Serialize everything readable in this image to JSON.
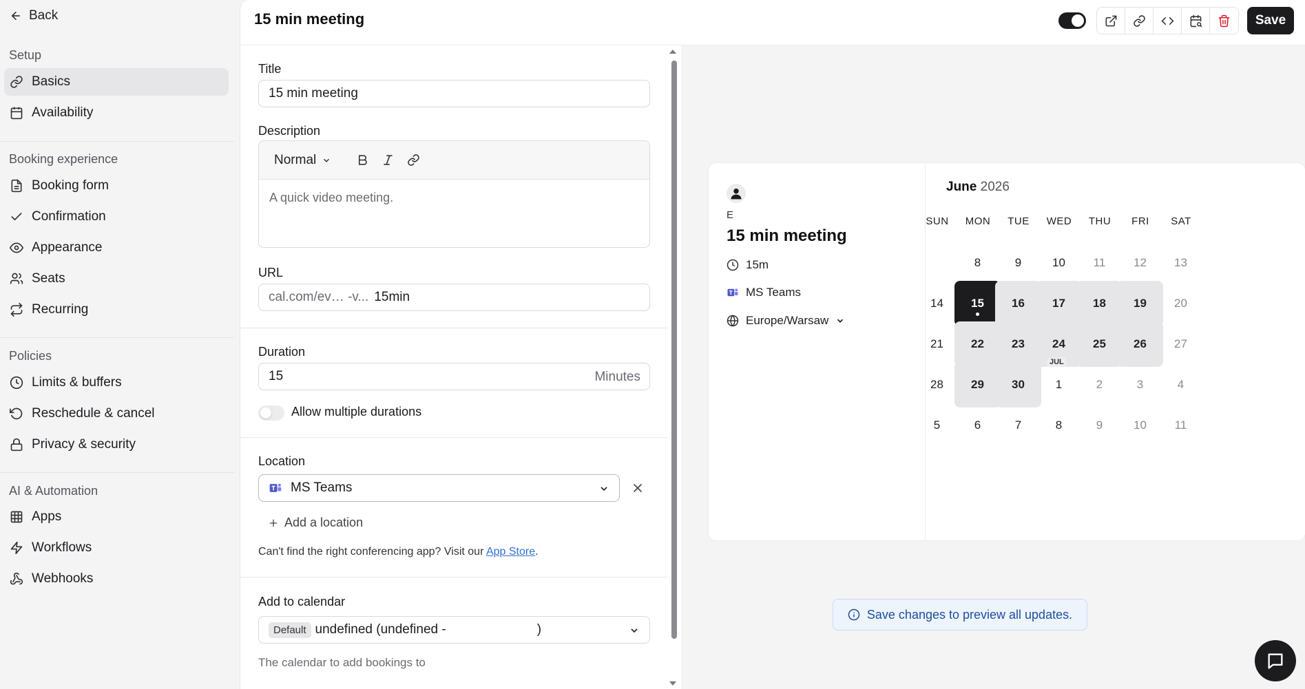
{
  "back_label": "Back",
  "sidebar": {
    "sections": [
      {
        "label": "Setup",
        "items": [
          {
            "label": "Basics",
            "icon": "link-icon",
            "active": true
          },
          {
            "label": "Availability",
            "icon": "calendar-icon"
          }
        ]
      },
      {
        "label": "Booking experience",
        "items": [
          {
            "label": "Booking form",
            "icon": "file-text-icon"
          },
          {
            "label": "Confirmation",
            "icon": "check-icon"
          },
          {
            "label": "Appearance",
            "icon": "eye-icon"
          },
          {
            "label": "Seats",
            "icon": "users-icon"
          },
          {
            "label": "Recurring",
            "icon": "repeat-icon"
          }
        ]
      },
      {
        "label": "Policies",
        "items": [
          {
            "label": "Limits & buffers",
            "icon": "clock-icon"
          },
          {
            "label": "Reschedule & cancel",
            "icon": "rotate-ccw-icon"
          },
          {
            "label": "Privacy & security",
            "icon": "lock-icon"
          }
        ]
      },
      {
        "label": "AI & Automation",
        "items": [
          {
            "label": "Apps",
            "icon": "grid-icon"
          },
          {
            "label": "Workflows",
            "icon": "zap-icon"
          },
          {
            "label": "Webhooks",
            "icon": "webhook-icon"
          }
        ]
      }
    ]
  },
  "header": {
    "title": "15 min meeting",
    "save_label": "Save"
  },
  "form": {
    "title_label": "Title",
    "title_value": "15 min meeting",
    "description_label": "Description",
    "format_label": "Normal",
    "description_placeholder": "A quick video meeting.",
    "url_label": "URL",
    "url_prefix": "cal.com/ev… -v...",
    "url_slug": "15min",
    "duration_label": "Duration",
    "duration_value": "15",
    "duration_unit": "Minutes",
    "multiple_durations_label": "Allow multiple durations",
    "location_label": "Location",
    "location_value": "MS Teams",
    "add_location_label": "Add a location",
    "conferencing_help_prefix": "Can't find the right conferencing app? Visit our",
    "app_store_link": "App Store",
    "conferencing_help_suffix": ".",
    "calendar_label": "Add to calendar",
    "calendar_badge": "Default",
    "calendar_value": "undefined (undefined -",
    "calendar_value_end": ")",
    "calendar_help": "The calendar to add bookings to"
  },
  "preview": {
    "host_initial": "E",
    "event_title": "15 min meeting",
    "duration": "15m",
    "location": "MS Teams",
    "timezone": "Europe/Warsaw",
    "month": "June",
    "year": "2026",
    "weekdays": [
      "SUN",
      "MON",
      "TUE",
      "WED",
      "THU",
      "FRI",
      "SAT"
    ],
    "next_month_badge": "JUL",
    "weeks": [
      [
        null,
        "8",
        "9",
        "10",
        "11",
        "12",
        "13"
      ],
      [
        "14",
        "15",
        "16",
        "17",
        "18",
        "19",
        "20"
      ],
      [
        "21",
        "22",
        "23",
        "24",
        "25",
        "26",
        "27"
      ],
      [
        "28",
        "29",
        "30",
        "1",
        "2",
        "3",
        "4"
      ],
      [
        "5",
        "6",
        "7",
        "8",
        "9",
        "10",
        "11"
      ]
    ],
    "available_days": [
      "16",
      "17",
      "18",
      "19",
      "22",
      "23",
      "24",
      "25",
      "26",
      "29",
      "30"
    ],
    "selected_day": "15",
    "notice": "Save changes to preview all updates."
  }
}
